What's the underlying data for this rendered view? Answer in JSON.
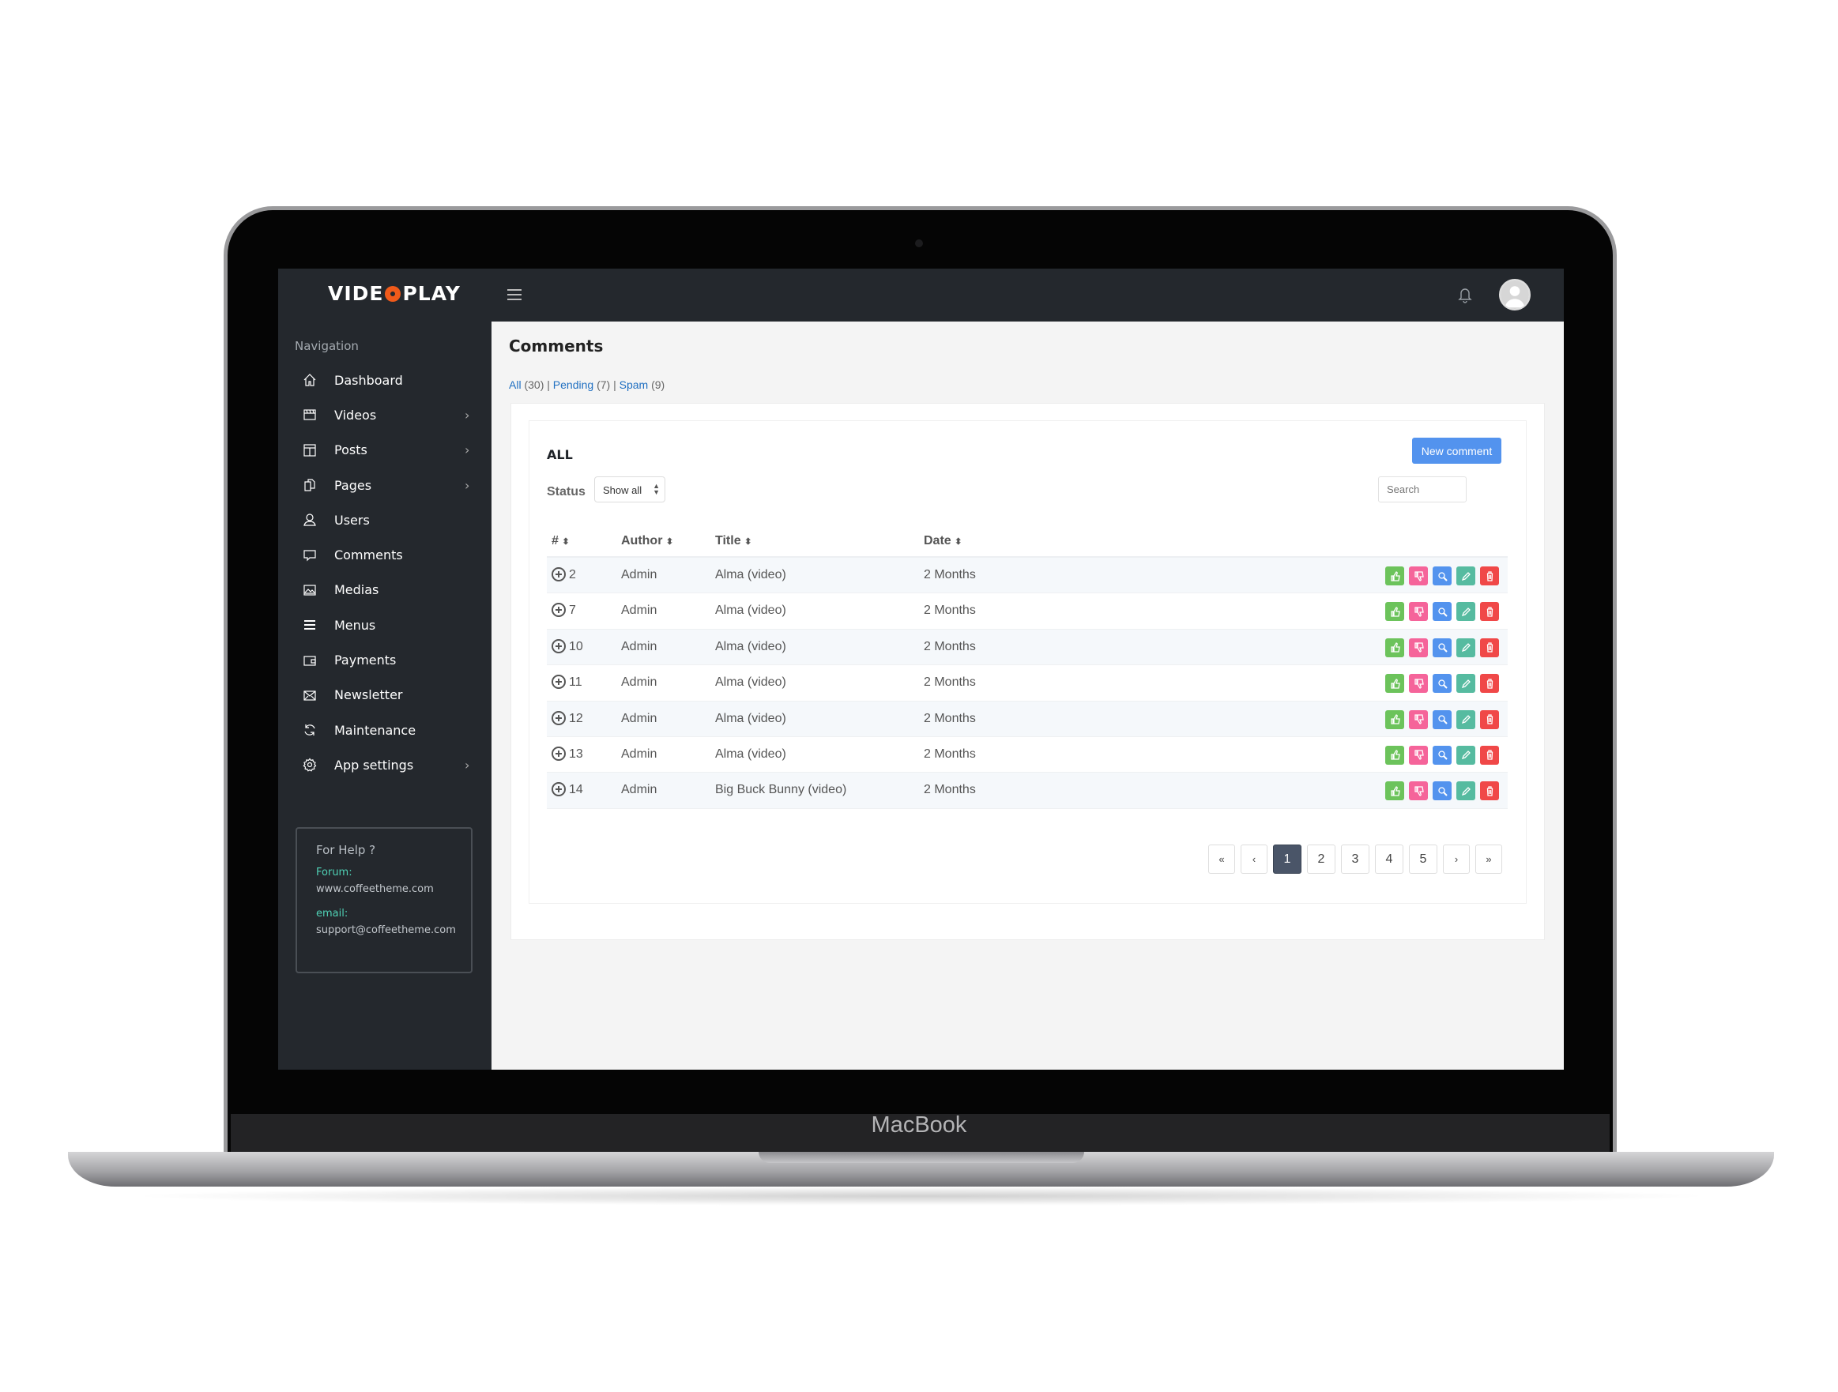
{
  "device": {
    "brand": "MacBook"
  },
  "app": {
    "logo_left": "VIDE",
    "logo_right": "PLAY",
    "logo_text": "VIDEOPLAY",
    "accent": "#f05a1a"
  },
  "topbar": {
    "menu_icon": "hamburger-icon",
    "bell_icon": "bell-icon",
    "avatar_icon": "user-avatar"
  },
  "sidebar": {
    "heading": "Navigation",
    "items": [
      {
        "label": "Dashboard",
        "icon": "home-icon",
        "submenu": false
      },
      {
        "label": "Videos",
        "icon": "film-icon",
        "submenu": true
      },
      {
        "label": "Posts",
        "icon": "layout-icon",
        "submenu": true
      },
      {
        "label": "Pages",
        "icon": "pages-icon",
        "submenu": true
      },
      {
        "label": "Users",
        "icon": "user-icon",
        "submenu": false
      },
      {
        "label": "Comments",
        "icon": "comment-icon",
        "submenu": false
      },
      {
        "label": "Medias",
        "icon": "image-icon",
        "submenu": false
      },
      {
        "label": "Menus",
        "icon": "menu-icon",
        "submenu": false
      },
      {
        "label": "Payments",
        "icon": "wallet-icon",
        "submenu": false
      },
      {
        "label": "Newsletter",
        "icon": "mail-icon",
        "submenu": false
      },
      {
        "label": "Maintenance",
        "icon": "refresh-icon",
        "submenu": false
      },
      {
        "label": "App settings",
        "icon": "gear-icon",
        "submenu": true
      }
    ],
    "help": {
      "title": "For Help ?",
      "forum_label": "Forum:",
      "forum_value": "www.coffeetheme.com",
      "email_label": "email:",
      "email_value": "support@coffeetheme.com"
    }
  },
  "main": {
    "title": "Comments",
    "filters": [
      {
        "label": "All",
        "count": "(30)"
      },
      {
        "label": "Pending",
        "count": "(7)"
      },
      {
        "label": "Spam",
        "count": "(9)"
      }
    ],
    "section_title": "ALL",
    "new_button": "New comment",
    "status_label": "Status",
    "status_value": "Show all",
    "search_placeholder": "Search",
    "columns": [
      "#",
      "Author",
      "Title",
      "Date"
    ],
    "rows": [
      {
        "id": "2",
        "author": "Admin",
        "title": "Alma (video)",
        "date": "2 Months"
      },
      {
        "id": "7",
        "author": "Admin",
        "title": "Alma (video)",
        "date": "2 Months"
      },
      {
        "id": "10",
        "author": "Admin",
        "title": "Alma (video)",
        "date": "2 Months"
      },
      {
        "id": "11",
        "author": "Admin",
        "title": "Alma (video)",
        "date": "2 Months"
      },
      {
        "id": "12",
        "author": "Admin",
        "title": "Alma (video)",
        "date": "2 Months"
      },
      {
        "id": "13",
        "author": "Admin",
        "title": "Alma (video)",
        "date": "2 Months"
      },
      {
        "id": "14",
        "author": "Admin",
        "title": "Big Buck Bunny (video)",
        "date": "2 Months"
      }
    ],
    "actions": [
      {
        "name": "approve",
        "icon": "thumbs-up-icon",
        "color": "#6cc35b"
      },
      {
        "name": "reject",
        "icon": "thumbs-down-icon",
        "color": "#f5649a"
      },
      {
        "name": "view",
        "icon": "search-icon",
        "color": "#5393ee"
      },
      {
        "name": "edit",
        "icon": "pencil-icon",
        "color": "#56bba0"
      },
      {
        "name": "delete",
        "icon": "trash-icon",
        "color": "#f04848"
      }
    ],
    "pagination": {
      "first": "«",
      "prev": "‹",
      "pages": [
        "1",
        "2",
        "3",
        "4",
        "5"
      ],
      "current": "1",
      "next": "›",
      "last": "»"
    }
  }
}
